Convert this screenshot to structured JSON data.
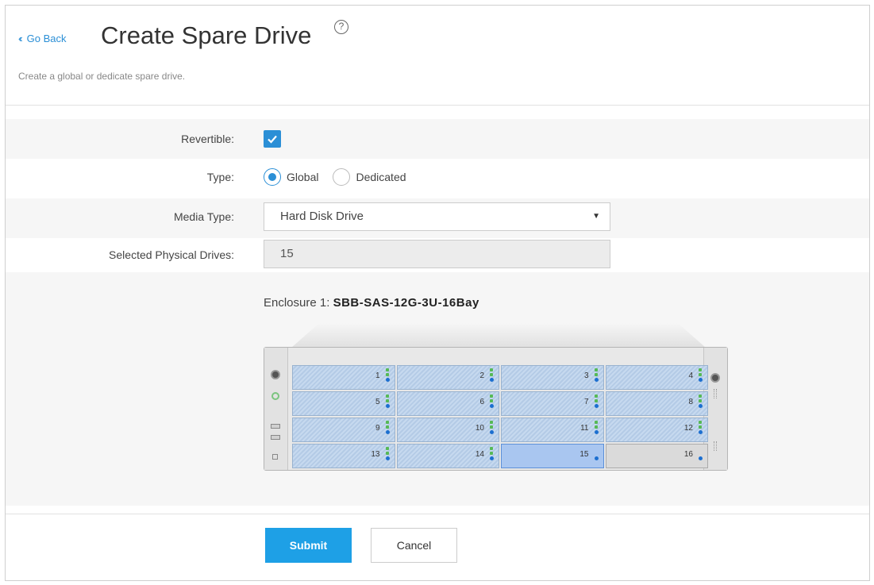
{
  "header": {
    "go_back": "Go Back",
    "title": "Create Spare Drive",
    "subtitle": "Create a global or dedicate spare drive."
  },
  "form": {
    "revertible": {
      "label": "Revertible:",
      "checked": true
    },
    "type": {
      "label": "Type:",
      "options": [
        {
          "label": "Global",
          "selected": true
        },
        {
          "label": "Dedicated",
          "selected": false
        }
      ]
    },
    "media_type": {
      "label": "Media Type:",
      "value": "Hard Disk Drive"
    },
    "selected_drives": {
      "label": "Selected Physical Drives:",
      "value": "15"
    }
  },
  "enclosure": {
    "label": "Enclosure 1:",
    "model": "SBB-SAS-12G-3U-16Bay",
    "bays": [
      {
        "num": "1",
        "state": "available"
      },
      {
        "num": "2",
        "state": "available"
      },
      {
        "num": "3",
        "state": "available"
      },
      {
        "num": "4",
        "state": "available"
      },
      {
        "num": "5",
        "state": "available"
      },
      {
        "num": "6",
        "state": "available"
      },
      {
        "num": "7",
        "state": "available"
      },
      {
        "num": "8",
        "state": "available"
      },
      {
        "num": "9",
        "state": "available"
      },
      {
        "num": "10",
        "state": "available"
      },
      {
        "num": "11",
        "state": "available"
      },
      {
        "num": "12",
        "state": "available"
      },
      {
        "num": "13",
        "state": "available"
      },
      {
        "num": "14",
        "state": "available"
      },
      {
        "num": "15",
        "state": "selected"
      },
      {
        "num": "16",
        "state": "empty"
      }
    ]
  },
  "actions": {
    "submit": "Submit",
    "cancel": "Cancel"
  },
  "colors": {
    "accent": "#2b8fd6",
    "submit": "#1ea0e6",
    "selected_bay": "#a9c6f0"
  }
}
